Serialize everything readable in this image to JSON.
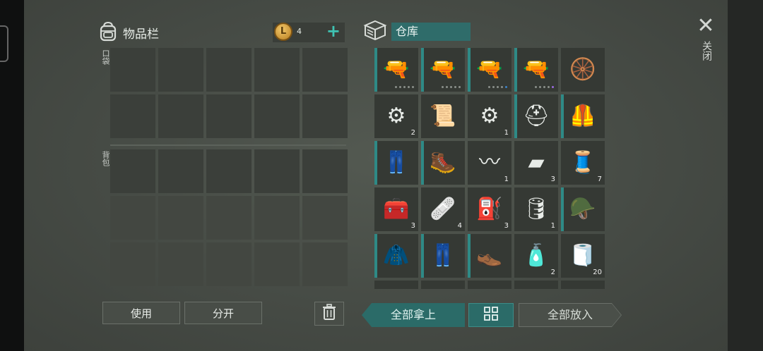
{
  "inventory": {
    "title": "物品栏",
    "coins": "4",
    "coin_symbol": "L",
    "add_icon": "plus-icon",
    "pocket_label": "口袋",
    "backpack_label": "背包"
  },
  "storage": {
    "title": "仓库",
    "items": [
      {
        "name": "smg-icon",
        "glyph": "🔫",
        "count": "",
        "dots": [
          "n",
          "n",
          "n",
          "n",
          "n"
        ],
        "marked": true
      },
      {
        "name": "rifle-icon",
        "glyph": "🔫",
        "count": "",
        "dots": [
          "n",
          "n",
          "n",
          "n",
          "n"
        ],
        "marked": true
      },
      {
        "name": "rifle-icon",
        "glyph": "🔫",
        "count": "",
        "dots": [
          "n",
          "n",
          "n",
          "n",
          "hl"
        ],
        "marked": true
      },
      {
        "name": "rifle-icon",
        "glyph": "🔫",
        "count": "",
        "dots": [
          "n",
          "n",
          "n",
          "n",
          "pl"
        ],
        "marked": true
      },
      {
        "name": "wheel-icon",
        "glyph": "🛞",
        "count": "",
        "marked": false
      },
      {
        "name": "engine-part-icon",
        "glyph": "⚙",
        "count": "2",
        "marked": false
      },
      {
        "name": "blueprint-icon",
        "glyph": "📜",
        "count": "",
        "marked": false
      },
      {
        "name": "gear-icon",
        "glyph": "⚙",
        "count": "1",
        "marked": false
      },
      {
        "name": "helmet-icon",
        "glyph": "⛑",
        "count": "",
        "marked": true
      },
      {
        "name": "body-armor-icon",
        "glyph": "🦺",
        "count": "",
        "marked": true
      },
      {
        "name": "tactical-pants-icon",
        "glyph": "👖",
        "count": "",
        "marked": true
      },
      {
        "name": "boots-icon",
        "glyph": "🥾",
        "count": "",
        "marked": true
      },
      {
        "name": "spring-icon",
        "glyph": "〰",
        "count": "1",
        "marked": false
      },
      {
        "name": "metal-bars-icon",
        "glyph": "▰",
        "count": "3",
        "marked": false
      },
      {
        "name": "wire-spool-icon",
        "glyph": "🧵",
        "count": "7",
        "marked": false
      },
      {
        "name": "medkit-icon",
        "glyph": "🧰",
        "count": "3",
        "marked": false
      },
      {
        "name": "bandage-icon",
        "glyph": "🩹",
        "count": "4",
        "marked": false
      },
      {
        "name": "jerrycan-icon",
        "glyph": "⛽",
        "count": "3",
        "marked": false
      },
      {
        "name": "filter-icon",
        "glyph": "🛢",
        "count": "1",
        "marked": false
      },
      {
        "name": "camo-hat-icon",
        "glyph": "🪖",
        "count": "",
        "marked": true
      },
      {
        "name": "camo-jacket-icon",
        "glyph": "🧥",
        "count": "",
        "marked": true
      },
      {
        "name": "camo-pants-icon",
        "glyph": "👖",
        "count": "",
        "marked": true
      },
      {
        "name": "shoes-icon",
        "glyph": "👞",
        "count": "",
        "marked": true
      },
      {
        "name": "spray-can-icon",
        "glyph": "🧴",
        "count": "2",
        "marked": false
      },
      {
        "name": "cloth-icon",
        "glyph": "🧻",
        "count": "20",
        "marked": false
      },
      {
        "name": "item-partial-icon",
        "glyph": "",
        "count": "",
        "marked": false
      },
      {
        "name": "item-partial-icon",
        "glyph": "",
        "count": "",
        "marked": false
      },
      {
        "name": "item-partial-icon",
        "glyph": "",
        "count": "",
        "marked": false
      },
      {
        "name": "item-partial-icon",
        "glyph": "",
        "count": "",
        "marked": false
      },
      {
        "name": "item-partial-icon",
        "glyph": "",
        "count": "",
        "marked": false
      }
    ]
  },
  "buttons": {
    "use": "使用",
    "split": "分开",
    "take_all": "全部拿上",
    "put_all": "全部放入",
    "close": "关闭"
  },
  "icons": {
    "backpack": "backpack-icon",
    "storage": "storage-box-icon",
    "trash": "trash-icon",
    "grid": "grid-view-icon",
    "close": "close-icon"
  },
  "colors": {
    "accent_teal": "#2b6b68",
    "plus": "#3fc3b3"
  }
}
